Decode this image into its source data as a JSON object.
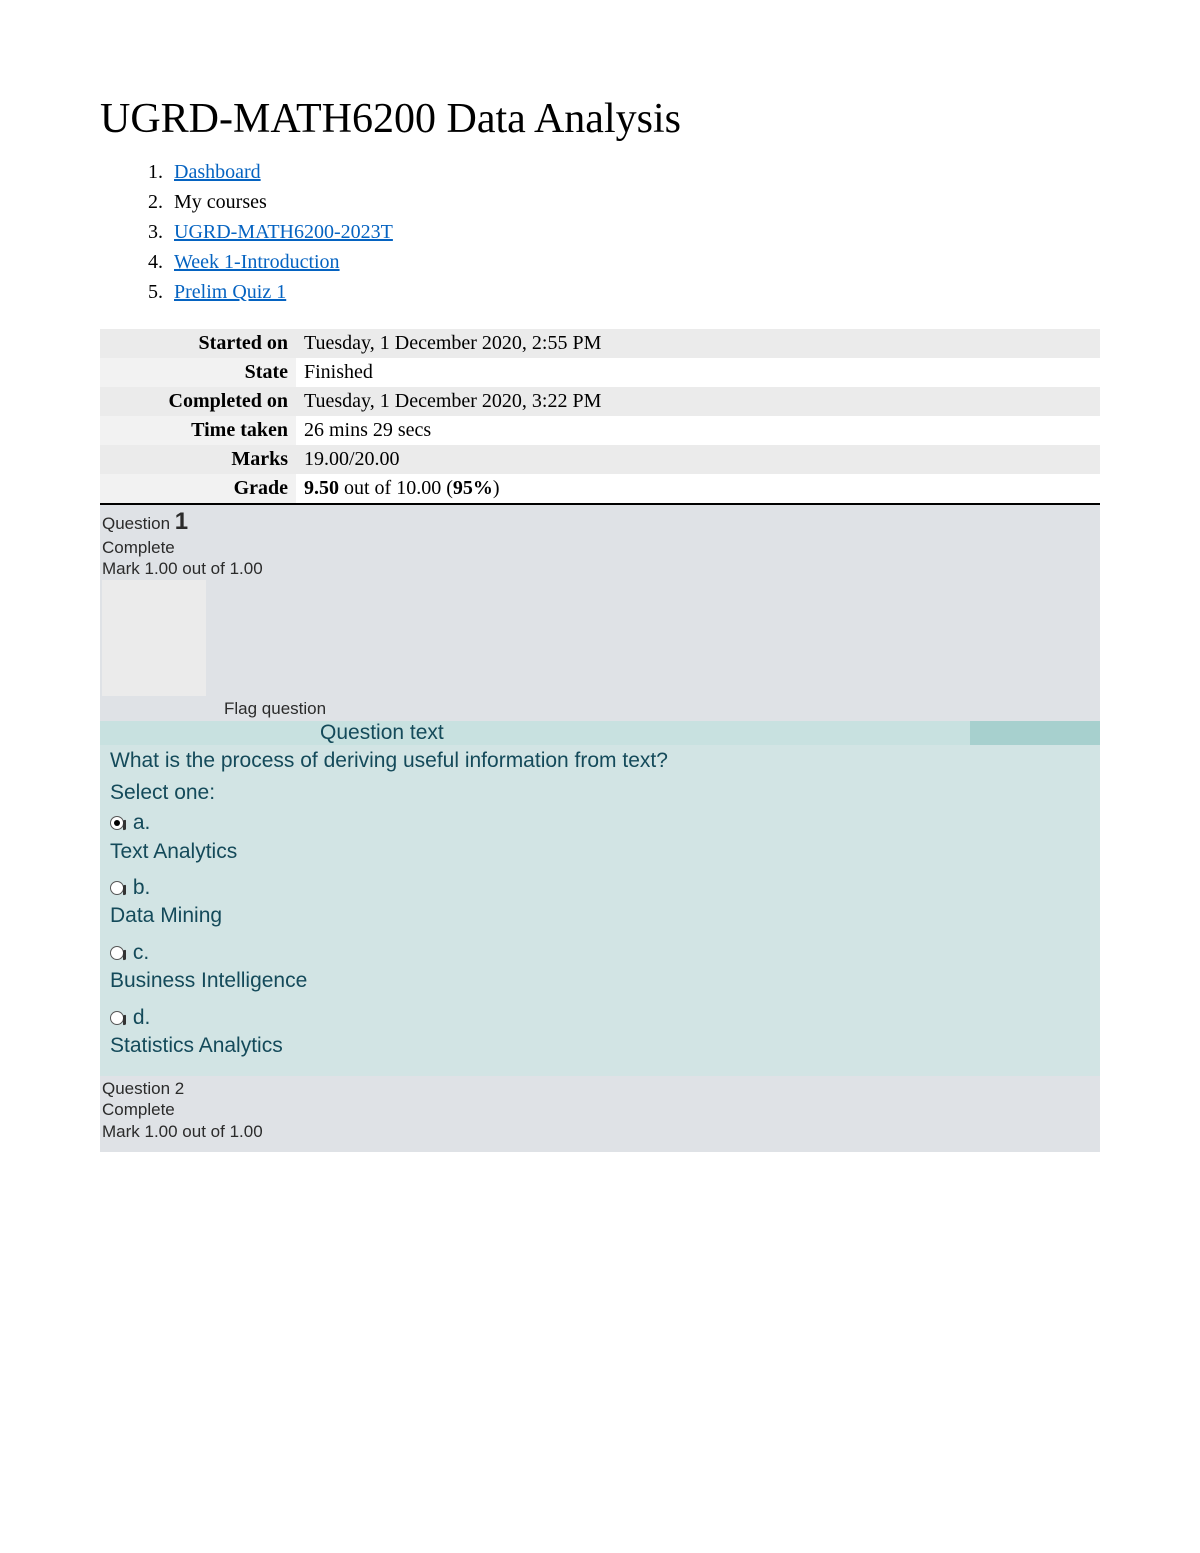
{
  "header": {
    "title": "UGRD-MATH6200 Data Analysis"
  },
  "breadcrumb": [
    {
      "label": "Dashboard",
      "link": true
    },
    {
      "label": "My courses",
      "link": false
    },
    {
      "label": "UGRD-MATH6200-2023T",
      "link": true
    },
    {
      "label": "Week 1-Introduction",
      "link": true
    },
    {
      "label": "Prelim Quiz 1",
      "link": true
    }
  ],
  "summary": {
    "started_label": "Started on",
    "started_value": "Tuesday, 1 December 2020, 2:55 PM",
    "state_label": "State",
    "state_value": "Finished",
    "completed_label": "Completed on",
    "completed_value": "Tuesday, 1 December 2020, 3:22 PM",
    "time_label": "Time taken",
    "time_value": "26 mins 29 secs",
    "marks_label": "Marks",
    "marks_value": "19.00/20.00",
    "grade_label": "Grade",
    "grade_value_bold1": "9.50",
    "grade_value_plain": " out of 10.00 (",
    "grade_value_bold2": "95%",
    "grade_value_close": ")"
  },
  "q1": {
    "question_word": "Question ",
    "number": "1",
    "state": "Complete",
    "mark": "Mark 1.00 out of 1.00",
    "flag": "Flag question",
    "question_text_label": "Question text",
    "prompt": " What is the process of deriving useful information from text?",
    "select": "Select one:",
    "options": [
      {
        "letter": "a.",
        "text": "Text Analytics",
        "selected": true
      },
      {
        "letter": "b.",
        "text": "Data Mining",
        "selected": false
      },
      {
        "letter": "c.",
        "text": "Business Intelligence",
        "selected": false
      },
      {
        "letter": "d.",
        "text": "Statistics Analytics",
        "selected": false
      }
    ]
  },
  "q2": {
    "question_word": "Question ",
    "number": "2",
    "state": "Complete",
    "mark": "Mark 1.00 out of 1.00"
  }
}
